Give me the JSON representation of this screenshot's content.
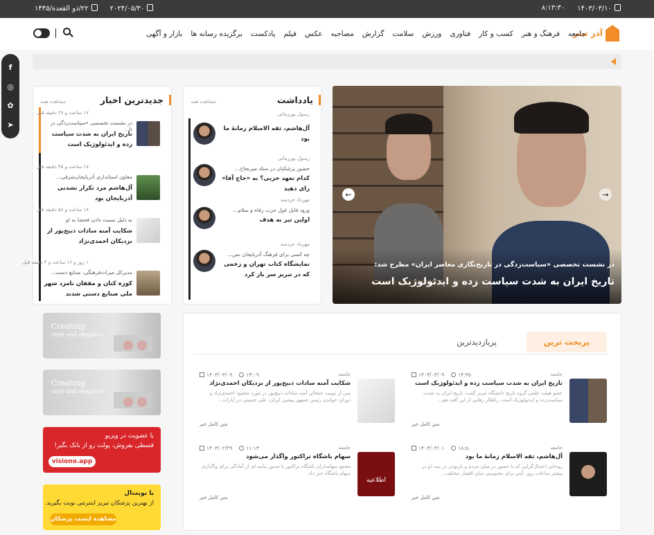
{
  "topbar": {
    "date_persian": "۱۴۰۳/۰۳/۱۰",
    "time": "۸:۱۳:۳۰",
    "date_gregorian": "۲۰۲۴/۰۵/۳۰",
    "date_hijri": "۲۲/ذو القعدة/۱۴۴۵"
  },
  "header": {
    "logo_text": "آذر تیتر",
    "nav": [
      "جامعه",
      "فرهنگ و هنر",
      "کسب و کار",
      "فناوری",
      "ورزش",
      "سلامت",
      "گزارش",
      "مصاحبه",
      "عکس",
      "فیلم",
      "پادکست",
      "برگزیده رسانه ها",
      "بازار و آگهی"
    ]
  },
  "social": [
    "facebook-icon",
    "instagram-icon",
    "aparat-icon",
    "telegram-icon"
  ],
  "hero": {
    "subtitle": "در نشست تخصصی «سیاست‌زدگی در تاریخ‌نگاری معاصر ایران» مطرح شد:",
    "title": "تاریخ ایران به شدت سیاست زده و ایدئولوژیک است"
  },
  "notes": {
    "title": "یادداشت",
    "see_all": "مشاهده همه",
    "items": [
      {
        "author": "رسول پورزمانی",
        "lead": "",
        "title": "آل‌هاشم، ثقه الاسلام زمانهٔ ما بود"
      },
      {
        "author": "رسول پورزمانی",
        "lead": "حضور پزشکیان در ستاد میرنجاح...",
        "title": "کدام تعهد حزبی؟ به «حاج آقا» رای دهید"
      },
      {
        "author": "مهرداد خردمند",
        "lead": "ورود فایل غول حزب رفاه و سلام...",
        "title": "اولین تیر به هدف"
      },
      {
        "author": "مهرداد خردمند",
        "lead": "چه کسی برای فرهنگ آذربایجان نس...",
        "title": "نمایشگاه کتاب تهران و زخمی که در تبریز سر باز کرد"
      }
    ]
  },
  "news": {
    "title": "جدیدترین اخبار",
    "see_all": "مشاهده همه",
    "items": [
      {
        "time": "۱۷ ساعت و ۲۷ دقیقه قبل",
        "lead": "در نشست تخصصی «سیاست‌زدگی در تا...",
        "title": "تاریخ ایران به شدت سیاست زده و ایدئولوژیک است"
      },
      {
        "time": "۱۷ ساعت و ۴۵ دقیقه قبل",
        "lead": "معاون استانداری آذربایجان‌شرقی...",
        "title": "آل‌هاشم مرد تکرار نشدنی آذربایجان بود"
      },
      {
        "time": "۱۸ ساعت و ۵۸ دقیقه قبل",
        "lead": "به دلیل نسبت دادن فحشا به او",
        "title": "شکایت آمنه سادات ذبیح‌پور از نزدیکان احمدی‌نژاد"
      },
      {
        "time": "۱ روز و ۱۶ ساعت و ۳ دقیقه قبل",
        "lead": "مدیرکل میراث‌فرهنگی، صنایع دست...",
        "title": "کوزه کنان و مقفان نامزد شهر ملی صنایع دستی شدند"
      }
    ]
  },
  "ads": {
    "grey1": [
      "Creating",
      "style and elegance"
    ],
    "grey2": [
      "Creating",
      "style and elegance"
    ],
    "red_line1": "با عضویت در ویزیو",
    "red_line2": "قسطی بفروش، پولت رو از بانک بگیر!",
    "red_pill": "visiono.app",
    "yellow_line1": "با نوبت‌ال",
    "yellow_line2": "از بهترین پزشکان تبریز اینترنتی نوبت بگیرید.",
    "yellow_pill": "مشاهده لیست پزشکان"
  },
  "tabs": {
    "active": "پربحث ترین",
    "inactive": "پربازدیدترین",
    "stories": [
      {
        "cat": "جامعه",
        "time": "۱۴:۴۵",
        "date": "۱۴۰۳/۰۳/۰۹",
        "title": "تاریخ ایران به شدت سیاست زده و ایدئولوژیک است",
        "lead": "عضو هیئت علمی گروه تاریخ دانشگاه تبریز گفت: تاریخ ایران به شدت سیاست‌زده و ایدئولوژیک است. راهکار رهایی از این آفت هم...",
        "more": "متن کامل خبر"
      },
      {
        "cat": "جامعه",
        "time": "۱۳:۰۹",
        "date": "۱۴۰۳/۰۳/۰۹",
        "title": "شکایت آمنه سادات ذبیح‌پور از نزدیکان احمدی‌نژاد",
        "lead": "پس از توییت جنجالی آمنه سادات ذبیح‌پور در مورد محمود احمدی‌نژاد و دوران خواندن رئیس جمهور پیشین ایران، علی حسینی در آپارات...",
        "more": "متن کامل خبر"
      },
      {
        "cat": "جامعه",
        "time": "۱۸:۵۰",
        "date": "۱۴۰۳/۰۳/۰۱",
        "title": "آل‌هاشم، ثقه الاسلام زمانهٔ ما بود",
        "lead": "روحانی اعتدال‌گرایی که با حضور در میان مردم و بازبودن در بیت او در بیشتر ساعات روز، آیتی برای محبوبیتی میان اقشار مختلف...",
        "more": "متن کامل خبر"
      },
      {
        "cat": "جامعه",
        "time": "۱۱:۱۳",
        "date": "۱۴۰۳/۰۲/۲۹",
        "title": "سهام باشگاه تراکتور واگذار می‌شود",
        "lead": "مجمع سهامداران باشگاه تراکتور با صدور بیانیه ای از آمادگی برای واگذاری سهام باشگاه خبر داد.",
        "more": "متن کامل خبر"
      }
    ],
    "announce_badge": "اطلاعیه"
  }
}
